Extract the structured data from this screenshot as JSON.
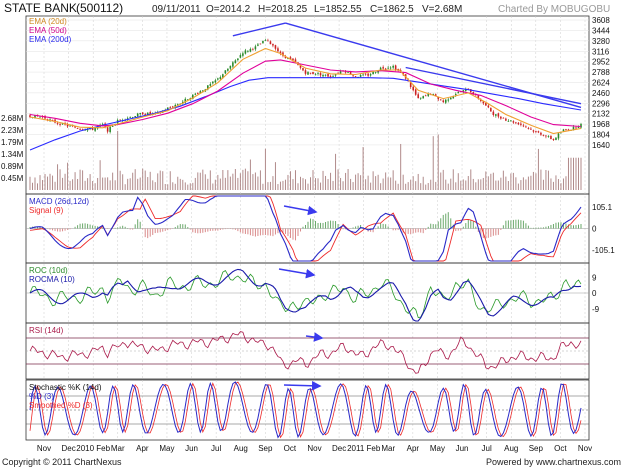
{
  "header": {
    "title": "STATE BANK",
    "symbol": "(500112)",
    "date": "09/11/2011",
    "open": "O=2014.2",
    "high": "H=2018.25",
    "low": "L=1852.55",
    "close": "C=1862.5",
    "volume": "V=2.68M",
    "credit": "Charted By MOBUGOBU"
  },
  "footer": {
    "copyright": "Copyright © 2011 ChartNexus",
    "powered": "Powered by www.chartnexus.com"
  },
  "colors": {
    "ema20": "#f0a030",
    "ema50": "#e0009a",
    "ema200": "#2a2aff",
    "candle_up": "#2a8a2a",
    "candle_down": "#cc2222",
    "trend": "#3a3aee",
    "macd": "#2a2ac8",
    "signal": "#ee2a2a",
    "roc": "#2a9a2a",
    "rocma": "#1a1aaa",
    "rsi": "#aa1a4a",
    "stoch_k": "#2a2ac8",
    "stoch_d": "#ee2a2a"
  },
  "chart_data": [
    {
      "type": "candlestick",
      "panel": "price",
      "legend": [
        "EMA (20d)",
        "EMA (50d)",
        "EMA (200d)"
      ],
      "yticks": [
        "3608",
        "3444",
        "3280",
        "3116",
        "2952",
        "2788",
        "2624",
        "2460",
        "2296",
        "2132",
        "1968",
        "1804",
        "1640"
      ],
      "ylim": [
        1560,
        3640
      ],
      "volume_ticks": [
        "2.68M",
        "2.23M",
        "1.79M",
        "1.34M",
        "0.89M",
        "0.45M"
      ],
      "volume_ylim": [
        0,
        2.9
      ],
      "xticks": [
        "Nov",
        "Dec",
        "2010 Feb",
        "Mar",
        "Apr",
        "May",
        "Jun",
        "Jul",
        "Aug",
        "Sep",
        "Oct",
        "Nov",
        "Dec",
        "2011 Feb",
        "Mar",
        "Apr",
        "May",
        "Jun",
        "Jul",
        "Aug",
        "Sep",
        "Oct",
        "Nov"
      ],
      "close_path": [
        [
          0,
          2100
        ],
        [
          10,
          2080
        ],
        [
          20,
          2000
        ],
        [
          30,
          1940
        ],
        [
          40,
          1900
        ],
        [
          50,
          1890
        ],
        [
          58,
          1960
        ],
        [
          62,
          1870
        ],
        [
          70,
          2020
        ],
        [
          80,
          2080
        ],
        [
          90,
          2140
        ],
        [
          100,
          2120
        ],
        [
          110,
          2220
        ],
        [
          120,
          2300
        ],
        [
          130,
          2420
        ],
        [
          140,
          2530
        ],
        [
          150,
          2680
        ],
        [
          160,
          2880
        ],
        [
          170,
          3100
        ],
        [
          180,
          3180
        ],
        [
          188,
          3290
        ],
        [
          195,
          3200
        ],
        [
          200,
          3070
        ],
        [
          210,
          2960
        ],
        [
          220,
          2780
        ],
        [
          230,
          2760
        ],
        [
          240,
          2720
        ],
        [
          250,
          2820
        ],
        [
          260,
          2720
        ],
        [
          270,
          2740
        ],
        [
          280,
          2850
        ],
        [
          290,
          2880
        ],
        [
          300,
          2700
        ],
        [
          310,
          2360
        ],
        [
          320,
          2450
        ],
        [
          330,
          2320
        ],
        [
          340,
          2450
        ],
        [
          350,
          2520
        ],
        [
          360,
          2340
        ],
        [
          370,
          2130
        ],
        [
          380,
          2040
        ],
        [
          390,
          1980
        ],
        [
          400,
          1880
        ],
        [
          410,
          1800
        ],
        [
          418,
          1720
        ],
        [
          425,
          1870
        ],
        [
          432,
          1890
        ],
        [
          440,
          1960
        ]
      ],
      "ema20_path": [
        [
          0,
          2080
        ],
        [
          20,
          2010
        ],
        [
          40,
          1920
        ],
        [
          58,
          1910
        ],
        [
          70,
          1970
        ],
        [
          90,
          2080
        ],
        [
          110,
          2180
        ],
        [
          130,
          2380
        ],
        [
          150,
          2620
        ],
        [
          170,
          2990
        ],
        [
          188,
          3160
        ],
        [
          200,
          3080
        ],
        [
          220,
          2850
        ],
        [
          240,
          2760
        ],
        [
          260,
          2750
        ],
        [
          280,
          2820
        ],
        [
          295,
          2820
        ],
        [
          310,
          2500
        ],
        [
          330,
          2370
        ],
        [
          350,
          2460
        ],
        [
          365,
          2300
        ],
        [
          380,
          2120
        ],
        [
          400,
          1950
        ],
        [
          418,
          1820
        ],
        [
          440,
          1900
        ]
      ],
      "ema50_path": [
        [
          0,
          2120
        ],
        [
          20,
          2060
        ],
        [
          40,
          1980
        ],
        [
          58,
          1940
        ],
        [
          70,
          1960
        ],
        [
          90,
          2040
        ],
        [
          110,
          2140
        ],
        [
          130,
          2290
        ],
        [
          150,
          2490
        ],
        [
          170,
          2770
        ],
        [
          188,
          2960
        ],
        [
          200,
          2980
        ],
        [
          220,
          2900
        ],
        [
          240,
          2820
        ],
        [
          260,
          2790
        ],
        [
          280,
          2810
        ],
        [
          300,
          2780
        ],
        [
          320,
          2600
        ],
        [
          340,
          2500
        ],
        [
          360,
          2420
        ],
        [
          380,
          2260
        ],
        [
          400,
          2080
        ],
        [
          418,
          1960
        ],
        [
          440,
          1930
        ]
      ],
      "ema200_path": [
        [
          0,
          1560
        ],
        [
          20,
          1720
        ],
        [
          40,
          1860
        ],
        [
          60,
          1960
        ],
        [
          80,
          2050
        ],
        [
          100,
          2140
        ],
        [
          120,
          2250
        ],
        [
          140,
          2400
        ],
        [
          160,
          2560
        ],
        [
          175,
          2660
        ],
        [
          190,
          2700
        ],
        [
          210,
          2700
        ],
        [
          230,
          2700
        ],
        [
          250,
          2700
        ],
        [
          270,
          2700
        ],
        [
          290,
          2690
        ],
        [
          310,
          2630
        ],
        [
          330,
          2570
        ],
        [
          350,
          2510
        ],
        [
          370,
          2440
        ],
        [
          390,
          2370
        ],
        [
          410,
          2290
        ],
        [
          440,
          2190
        ]
      ],
      "trendlines": [
        [
          [
            162,
            3360
          ],
          [
            204,
            3560
          ]
        ],
        [
          [
            204,
            3560
          ],
          [
            440,
            2230
          ]
        ],
        [
          [
            300,
            2860
          ],
          [
            440,
            2290
          ]
        ]
      ]
    },
    {
      "type": "line",
      "panel": "macd",
      "legend": [
        "MACD (26d,12d)",
        "Signal (9)"
      ],
      "yticks": [
        "105.1",
        "0",
        "-105.1"
      ],
      "ylim": [
        -160,
        160
      ]
    },
    {
      "type": "line",
      "panel": "roc",
      "legend": [
        "ROC (10d)",
        "ROCMA (10)"
      ],
      "yticks": [
        "9",
        "0",
        "-9"
      ],
      "ylim": [
        -16,
        16
      ]
    },
    {
      "type": "line",
      "panel": "rsi",
      "legend": [
        "RSI (14d)"
      ],
      "yticks": [],
      "ylim": [
        10,
        90
      ],
      "bands": [
        70,
        30
      ]
    },
    {
      "type": "line",
      "panel": "stochastic",
      "legend": [
        "Stochastic %K (14d)",
        "%D (3)",
        "Smoothed %D (3)"
      ],
      "yticks": [],
      "ylim": [
        -10,
        110
      ],
      "bands": [
        80,
        50,
        20
      ]
    }
  ]
}
